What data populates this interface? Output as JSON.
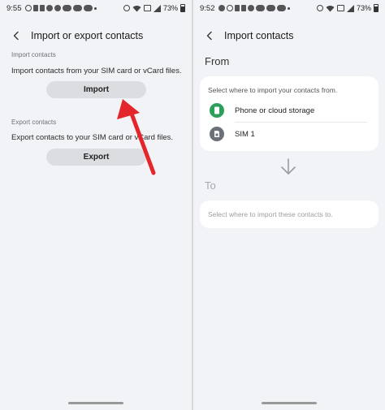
{
  "left": {
    "status": {
      "time": "9:55",
      "battery": "73%",
      "icons": [
        "whatsapp-icon",
        "pause-icon",
        "pause-icon",
        "twitter-icon",
        "twitter-icon",
        "app-badge-icon",
        "app-badge-icon",
        "app-badge-icon",
        "dot-icon"
      ],
      "right_icons": [
        "alarm-icon",
        "wifi-icon",
        "volte-icon",
        "signal-icon",
        "battery-icon"
      ]
    },
    "header": {
      "title": "Import or export contacts"
    },
    "import_section": {
      "label": "Import contacts",
      "description": "Import contacts from your SIM card or vCard files.",
      "button": "Import"
    },
    "export_section": {
      "label": "Export contacts",
      "description": "Export contacts to your SIM card or vCard files.",
      "button": "Export"
    }
  },
  "right": {
    "status": {
      "time": "9:52",
      "battery": "73%"
    },
    "header": {
      "title": "Import contacts"
    },
    "from_label": "From",
    "from_card": {
      "hint": "Select where to import your contacts from.",
      "options": [
        {
          "label": "Phone or cloud storage",
          "color": "#2e9e5b",
          "icon": "phone-storage-icon"
        },
        {
          "label": "SIM 1",
          "color": "#6b7079",
          "icon": "sim-card-icon"
        }
      ]
    },
    "to_label": "To",
    "to_card": {
      "hint": "Select where to import these contacts to."
    }
  },
  "annotation": {
    "arrow_color": "#e3262b"
  }
}
